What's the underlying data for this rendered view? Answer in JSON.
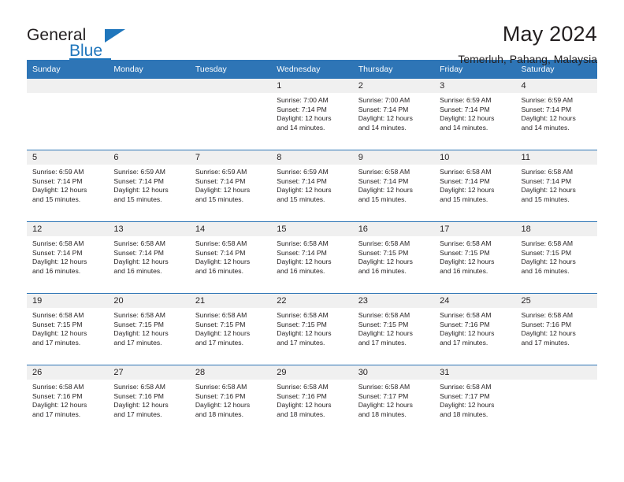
{
  "brand": {
    "line1": "General",
    "line2": "Blue",
    "flag_color": "#1f76bc"
  },
  "header": {
    "title": "May 2024",
    "location": "Temerluh, Pahang, Malaysia"
  },
  "theme": {
    "header_blue": "#2e75b6",
    "daynum_band": "#f0f0f0",
    "text": "#231f20"
  },
  "weekday_headers": [
    "Sunday",
    "Monday",
    "Tuesday",
    "Wednesday",
    "Thursday",
    "Friday",
    "Saturday"
  ],
  "weeks": [
    [
      {
        "day": "",
        "empty": true,
        "sunrise": "",
        "sunset": "",
        "daylight1": "",
        "daylight2": ""
      },
      {
        "day": "",
        "empty": true,
        "sunrise": "",
        "sunset": "",
        "daylight1": "",
        "daylight2": ""
      },
      {
        "day": "",
        "empty": true,
        "sunrise": "",
        "sunset": "",
        "daylight1": "",
        "daylight2": ""
      },
      {
        "day": "1",
        "sunrise": "Sunrise: 7:00 AM",
        "sunset": "Sunset: 7:14 PM",
        "daylight1": "Daylight: 12 hours",
        "daylight2": "and 14 minutes."
      },
      {
        "day": "2",
        "sunrise": "Sunrise: 7:00 AM",
        "sunset": "Sunset: 7:14 PM",
        "daylight1": "Daylight: 12 hours",
        "daylight2": "and 14 minutes."
      },
      {
        "day": "3",
        "sunrise": "Sunrise: 6:59 AM",
        "sunset": "Sunset: 7:14 PM",
        "daylight1": "Daylight: 12 hours",
        "daylight2": "and 14 minutes."
      },
      {
        "day": "4",
        "sunrise": "Sunrise: 6:59 AM",
        "sunset": "Sunset: 7:14 PM",
        "daylight1": "Daylight: 12 hours",
        "daylight2": "and 14 minutes."
      }
    ],
    [
      {
        "day": "5",
        "sunrise": "Sunrise: 6:59 AM",
        "sunset": "Sunset: 7:14 PM",
        "daylight1": "Daylight: 12 hours",
        "daylight2": "and 15 minutes."
      },
      {
        "day": "6",
        "sunrise": "Sunrise: 6:59 AM",
        "sunset": "Sunset: 7:14 PM",
        "daylight1": "Daylight: 12 hours",
        "daylight2": "and 15 minutes."
      },
      {
        "day": "7",
        "sunrise": "Sunrise: 6:59 AM",
        "sunset": "Sunset: 7:14 PM",
        "daylight1": "Daylight: 12 hours",
        "daylight2": "and 15 minutes."
      },
      {
        "day": "8",
        "sunrise": "Sunrise: 6:59 AM",
        "sunset": "Sunset: 7:14 PM",
        "daylight1": "Daylight: 12 hours",
        "daylight2": "and 15 minutes."
      },
      {
        "day": "9",
        "sunrise": "Sunrise: 6:58 AM",
        "sunset": "Sunset: 7:14 PM",
        "daylight1": "Daylight: 12 hours",
        "daylight2": "and 15 minutes."
      },
      {
        "day": "10",
        "sunrise": "Sunrise: 6:58 AM",
        "sunset": "Sunset: 7:14 PM",
        "daylight1": "Daylight: 12 hours",
        "daylight2": "and 15 minutes."
      },
      {
        "day": "11",
        "sunrise": "Sunrise: 6:58 AM",
        "sunset": "Sunset: 7:14 PM",
        "daylight1": "Daylight: 12 hours",
        "daylight2": "and 15 minutes."
      }
    ],
    [
      {
        "day": "12",
        "sunrise": "Sunrise: 6:58 AM",
        "sunset": "Sunset: 7:14 PM",
        "daylight1": "Daylight: 12 hours",
        "daylight2": "and 16 minutes."
      },
      {
        "day": "13",
        "sunrise": "Sunrise: 6:58 AM",
        "sunset": "Sunset: 7:14 PM",
        "daylight1": "Daylight: 12 hours",
        "daylight2": "and 16 minutes."
      },
      {
        "day": "14",
        "sunrise": "Sunrise: 6:58 AM",
        "sunset": "Sunset: 7:14 PM",
        "daylight1": "Daylight: 12 hours",
        "daylight2": "and 16 minutes."
      },
      {
        "day": "15",
        "sunrise": "Sunrise: 6:58 AM",
        "sunset": "Sunset: 7:14 PM",
        "daylight1": "Daylight: 12 hours",
        "daylight2": "and 16 minutes."
      },
      {
        "day": "16",
        "sunrise": "Sunrise: 6:58 AM",
        "sunset": "Sunset: 7:15 PM",
        "daylight1": "Daylight: 12 hours",
        "daylight2": "and 16 minutes."
      },
      {
        "day": "17",
        "sunrise": "Sunrise: 6:58 AM",
        "sunset": "Sunset: 7:15 PM",
        "daylight1": "Daylight: 12 hours",
        "daylight2": "and 16 minutes."
      },
      {
        "day": "18",
        "sunrise": "Sunrise: 6:58 AM",
        "sunset": "Sunset: 7:15 PM",
        "daylight1": "Daylight: 12 hours",
        "daylight2": "and 16 minutes."
      }
    ],
    [
      {
        "day": "19",
        "sunrise": "Sunrise: 6:58 AM",
        "sunset": "Sunset: 7:15 PM",
        "daylight1": "Daylight: 12 hours",
        "daylight2": "and 17 minutes."
      },
      {
        "day": "20",
        "sunrise": "Sunrise: 6:58 AM",
        "sunset": "Sunset: 7:15 PM",
        "daylight1": "Daylight: 12 hours",
        "daylight2": "and 17 minutes."
      },
      {
        "day": "21",
        "sunrise": "Sunrise: 6:58 AM",
        "sunset": "Sunset: 7:15 PM",
        "daylight1": "Daylight: 12 hours",
        "daylight2": "and 17 minutes."
      },
      {
        "day": "22",
        "sunrise": "Sunrise: 6:58 AM",
        "sunset": "Sunset: 7:15 PM",
        "daylight1": "Daylight: 12 hours",
        "daylight2": "and 17 minutes."
      },
      {
        "day": "23",
        "sunrise": "Sunrise: 6:58 AM",
        "sunset": "Sunset: 7:15 PM",
        "daylight1": "Daylight: 12 hours",
        "daylight2": "and 17 minutes."
      },
      {
        "day": "24",
        "sunrise": "Sunrise: 6:58 AM",
        "sunset": "Sunset: 7:16 PM",
        "daylight1": "Daylight: 12 hours",
        "daylight2": "and 17 minutes."
      },
      {
        "day": "25",
        "sunrise": "Sunrise: 6:58 AM",
        "sunset": "Sunset: 7:16 PM",
        "daylight1": "Daylight: 12 hours",
        "daylight2": "and 17 minutes."
      }
    ],
    [
      {
        "day": "26",
        "sunrise": "Sunrise: 6:58 AM",
        "sunset": "Sunset: 7:16 PM",
        "daylight1": "Daylight: 12 hours",
        "daylight2": "and 17 minutes."
      },
      {
        "day": "27",
        "sunrise": "Sunrise: 6:58 AM",
        "sunset": "Sunset: 7:16 PM",
        "daylight1": "Daylight: 12 hours",
        "daylight2": "and 17 minutes."
      },
      {
        "day": "28",
        "sunrise": "Sunrise: 6:58 AM",
        "sunset": "Sunset: 7:16 PM",
        "daylight1": "Daylight: 12 hours",
        "daylight2": "and 18 minutes."
      },
      {
        "day": "29",
        "sunrise": "Sunrise: 6:58 AM",
        "sunset": "Sunset: 7:16 PM",
        "daylight1": "Daylight: 12 hours",
        "daylight2": "and 18 minutes."
      },
      {
        "day": "30",
        "sunrise": "Sunrise: 6:58 AM",
        "sunset": "Sunset: 7:17 PM",
        "daylight1": "Daylight: 12 hours",
        "daylight2": "and 18 minutes."
      },
      {
        "day": "31",
        "sunrise": "Sunrise: 6:58 AM",
        "sunset": "Sunset: 7:17 PM",
        "daylight1": "Daylight: 12 hours",
        "daylight2": "and 18 minutes."
      },
      {
        "day": "",
        "empty": true,
        "sunrise": "",
        "sunset": "",
        "daylight1": "",
        "daylight2": ""
      }
    ]
  ]
}
